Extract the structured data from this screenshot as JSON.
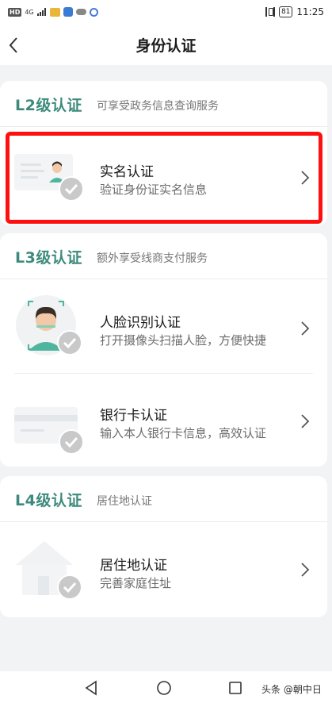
{
  "status_bar": {
    "hd": "HD",
    "network": "4G",
    "battery": "81",
    "time": "11:25"
  },
  "header": {
    "title": "身份认证"
  },
  "sections": [
    {
      "level": "L2级认证",
      "description": "可享受政务信息查询服务",
      "items": [
        {
          "title": "实名认证",
          "subtitle": "验证身份证实名信息",
          "icon": "id-card-icon"
        }
      ]
    },
    {
      "level": "L3级认证",
      "description": "额外享受线商支付服务",
      "items": [
        {
          "title": "人脸识别认证",
          "subtitle": "打开摄像头扫描人脸，方便快捷",
          "icon": "face-scan-icon"
        },
        {
          "title": "银行卡认证",
          "subtitle": "输入本人银行卡信息，高效认证",
          "icon": "bank-card-icon"
        }
      ]
    },
    {
      "level": "L4级认证",
      "description": "居住地认证",
      "items": [
        {
          "title": "居住地认证",
          "subtitle": "完善家庭住址",
          "icon": "house-icon"
        }
      ]
    }
  ],
  "watermark": "头条 @朝中日",
  "colors": {
    "level_label": "#3d8a7c",
    "highlight": "#ff1010",
    "background": "#f2f3f5"
  }
}
